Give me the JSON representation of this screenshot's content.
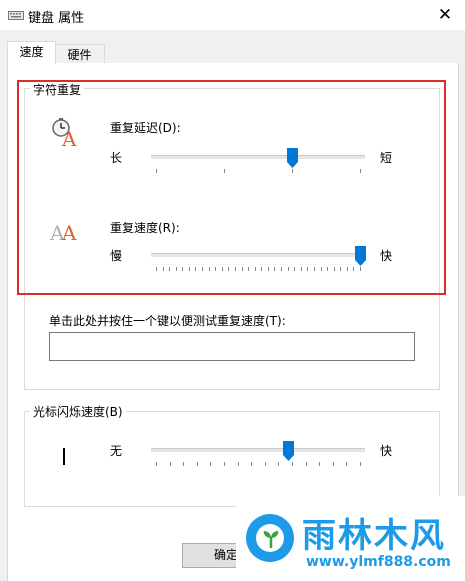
{
  "window": {
    "title": "键盘 属性",
    "close_glyph": "✕"
  },
  "tabs": [
    {
      "label": "速度",
      "active": true
    },
    {
      "label": "硬件",
      "active": false
    }
  ],
  "char_repeat": {
    "group_label": "字符重复",
    "delay": {
      "label": "重复延迟(D):",
      "min_label": "长",
      "max_label": "短",
      "value_fraction": 0.67,
      "ticks": 4
    },
    "rate": {
      "label": "重复速度(R):",
      "min_label": "慢",
      "max_label": "快",
      "value_fraction": 1.0,
      "ticks": 32
    },
    "test": {
      "label": "单击此处并按住一个键以便测试重复速度(T):",
      "value": ""
    }
  },
  "cursor_blink": {
    "group_label": "光标闪烁速度(B)",
    "min_label": "无",
    "max_label": "快",
    "value_fraction": 0.65,
    "ticks": 16
  },
  "buttons": {
    "ok": "确定"
  },
  "watermark": {
    "name": "雨林木风",
    "url": "www.ylmf888.com"
  },
  "colors": {
    "accent": "#0078d7",
    "highlight": "#e02a2a",
    "brand": "#1e9be8"
  }
}
